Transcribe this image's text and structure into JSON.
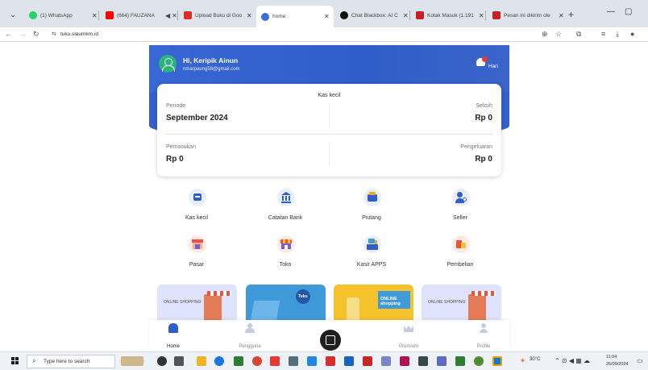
{
  "browser": {
    "tabs": [
      {
        "title": "(1) WhatsApp",
        "color": "#25d366",
        "active": false
      },
      {
        "title": "(664) FAUZANA",
        "color": "#ff0000",
        "active": false
      },
      {
        "title": "Upload Buku di Goo",
        "color": "#d93025",
        "active": false
      },
      {
        "title": "home",
        "color": "#3b6fd8",
        "active": true
      },
      {
        "title": "Chat Blackbox: AI C",
        "color": "#111111",
        "active": false
      },
      {
        "title": "Kotak Masuk (1.191",
        "color": "#c5221f",
        "active": false
      },
      {
        "title": "Pesan ini dikirim ole",
        "color": "#c5221f",
        "active": false
      }
    ],
    "url": "tuku.slaumkm.id",
    "win_minimize": "—",
    "win_restore": "▢"
  },
  "header": {
    "greeting": "Hi, Keripik Ainun",
    "email": "nmarpaung58@gmail.com",
    "notif_label": "Hari"
  },
  "card": {
    "title": "Kas kecil",
    "periode_label": "Periode",
    "periode_value": "September 2024",
    "selisih_label": "Selisih",
    "selisih_value": "Rp 0",
    "pemasukan_label": "Pemasukan",
    "pemasukan_value": "Rp 0",
    "pengeluaran_label": "Pengeluaran",
    "pengeluaran_value": "Rp 0"
  },
  "menu": [
    {
      "label": "Kas kecil",
      "icon": "cash-register-icon"
    },
    {
      "label": "Catatan Bank",
      "icon": "bank-icon"
    },
    {
      "label": "Piutang",
      "icon": "wallet-icon"
    },
    {
      "label": "Seller",
      "icon": "seller-icon"
    },
    {
      "label": "Pasar",
      "icon": "market-icon"
    },
    {
      "label": "Toko",
      "icon": "store-icon"
    },
    {
      "label": "Kasir APPS",
      "icon": "pos-icon"
    },
    {
      "label": "Pembelian",
      "icon": "purchase-icon"
    }
  ],
  "banners": [
    {
      "text": "ONLINE SHOPPING",
      "bg": "#dfe3ff"
    },
    {
      "text": "Tuku",
      "bg": "#3f9ad9"
    },
    {
      "text": "ONLINE shopping",
      "bg": "#f5c22b"
    },
    {
      "text": "ONLINE SHOPPING",
      "bg": "#dfe3ff"
    }
  ],
  "bottom_nav": [
    {
      "label": "Home",
      "active": true
    },
    {
      "label": "Pengguna",
      "active": false
    },
    {
      "label": "Premium",
      "active": false
    },
    {
      "label": "Profile",
      "active": false
    }
  ],
  "taskbar": {
    "search_placeholder": "Type here to search",
    "temperature": "30°C",
    "time": "11:04",
    "date": "25/09/2024"
  },
  "colors": {
    "primary": "#3561cd",
    "accent_green": "#29b57a",
    "notification": "#e53935"
  }
}
